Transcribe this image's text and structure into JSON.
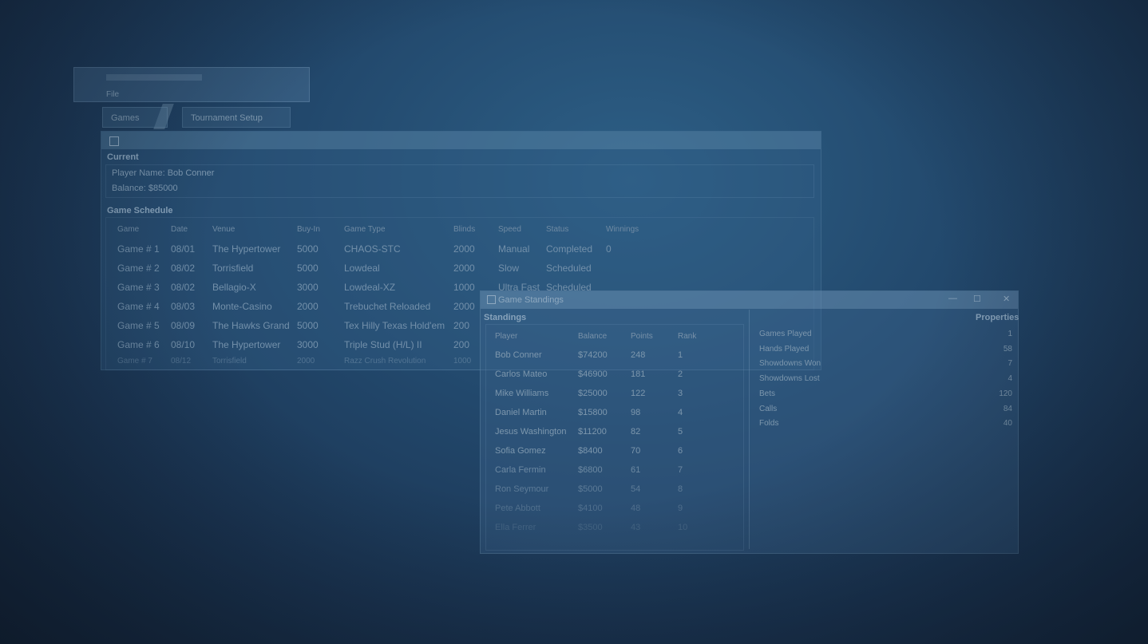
{
  "small_window": {
    "title": "",
    "subtitle": "File"
  },
  "tabs": [
    {
      "label": "Games"
    },
    {
      "label": "Tournament Setup"
    }
  ],
  "main_window": {
    "sections": {
      "current": "Current",
      "schedule": "Game Schedule"
    },
    "current_lines": [
      "Player Name: Bob Conner",
      "Balance: $85000"
    ],
    "columns": [
      "Game",
      "Date",
      "Venue",
      "Buy-In",
      "Game Type",
      "Blinds",
      "Speed",
      "Status",
      "Winnings"
    ],
    "rows": [
      [
        "Game # 1",
        "08/01",
        "The Hypertower",
        "5000",
        "CHAOS-STC",
        "2000",
        "Manual",
        "Completed",
        "0"
      ],
      [
        "Game # 2",
        "08/02",
        "Torrisfield",
        "5000",
        "Lowdeal",
        "2000",
        "Slow",
        "Scheduled",
        ""
      ],
      [
        "Game # 3",
        "08/02",
        "Bellagio-X",
        "3000",
        "Lowdeal-XZ",
        "1000",
        "Ultra Fast",
        "Scheduled",
        ""
      ],
      [
        "Game # 4",
        "08/03",
        "Monte-Casino",
        "2000",
        "Trebuchet Reloaded",
        "2000",
        "",
        "",
        ""
      ],
      [
        "Game # 5",
        "08/09",
        "The Hawks Grand",
        "5000",
        "Tex Hilly Texas Hold'em",
        "200",
        "",
        "",
        ""
      ],
      [
        "Game # 6",
        "08/10",
        "The Hypertower",
        "3000",
        "Triple Stud (H/L) II",
        "200",
        "",
        "",
        ""
      ],
      [
        "Game # 7",
        "08/12",
        "Torrisfield",
        "2000",
        "Razz Crush Revolution",
        "1000",
        "",
        "",
        ""
      ]
    ]
  },
  "standings_window": {
    "title": "Game Standings",
    "controls": {
      "minimize": "—",
      "maximize": "☐",
      "close": "✕"
    },
    "sections": {
      "standings": "Standings",
      "properties": "Properties"
    },
    "columns": [
      "Player",
      "Balance",
      "Points",
      "Rank"
    ],
    "rows": [
      [
        "Bob Conner",
        "$74200",
        "248",
        "1"
      ],
      [
        "Carlos Mateo",
        "$46900",
        "181",
        "2"
      ],
      [
        "Mike Williams",
        "$25000",
        "122",
        "3"
      ],
      [
        "Daniel Martin",
        "$15800",
        "98",
        "4"
      ],
      [
        "Jesus Washington",
        "$11200",
        "82",
        "5"
      ],
      [
        "Sofia Gomez",
        "$8400",
        "70",
        "6"
      ],
      [
        "Carla Fermin",
        "$6800",
        "61",
        "7"
      ],
      [
        "Ron Seymour",
        "$5000",
        "54",
        "8"
      ],
      [
        "Pete Abbott",
        "$4100",
        "48",
        "9"
      ],
      [
        "Ella Ferrer",
        "$3500",
        "43",
        "10"
      ]
    ],
    "properties": [
      {
        "label": "Games Played",
        "value": "1"
      },
      {
        "label": "Hands Played",
        "value": "58"
      },
      {
        "label": "Showdowns Won",
        "value": "7"
      },
      {
        "label": "Showdowns Lost",
        "value": "4"
      },
      {
        "label": "Bets",
        "value": "120"
      },
      {
        "label": "Calls",
        "value": "84"
      },
      {
        "label": "Folds",
        "value": "40"
      }
    ]
  }
}
